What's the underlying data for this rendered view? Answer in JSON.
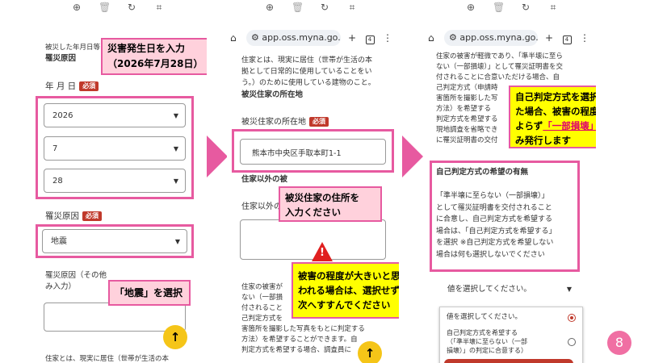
{
  "toolbar_icons": [
    "zoom-in-icon",
    "trash-icon",
    "rotate-icon",
    "crop-icon"
  ],
  "panel1": {
    "header_line1": "被災した年月日等",
    "header_line2": "罹災原因",
    "date_label": "年 月 日",
    "required": "必須",
    "year_value": "2026",
    "month_value": "7",
    "day_value": "28",
    "cause_label": "罹災原因",
    "cause_value": "地震",
    "other_label_line1": "罹災原因（その他",
    "other_label_line2": "み入力）",
    "bottom_text": "住家とは、現実に居住（世帯が生活の本",
    "callout_date_line1": "災害発生日を入力",
    "callout_date_line2": "（2026年7月28日）",
    "callout_cause": "「地震」を選択"
  },
  "panel2": {
    "url": "app.oss.myna.go.jp",
    "intro_line1": "住家とは、現実に居住（世帯が生活の本",
    "intro_line2": "拠として日常的に使用していることをい",
    "intro_line3": "う。）のために使用している建物のこと。",
    "section_title": "被災住家の所在地",
    "address_label": "被災住家の所在地",
    "required": "必須",
    "address_value": "熊本市中央区手取本町1-1",
    "section2_title": "住家以外の被",
    "other_label": "住家以外の",
    "lower_lines": [
      "住家の被害が",
      "ない（一部損",
      "付されること",
      "己判定方式を",
      "害箇所を撮影した写真をもとに判定する",
      "方法）を希望することができます。自",
      "判定方式を希望する場合、調査員に"
    ],
    "callout_address_line1": "被災住家の住所を",
    "callout_address_line2": "入力ください",
    "callout_warn_line1": "被害の程度が大きいと思",
    "callout_warn_line2": "われる場合は、選択せずに",
    "callout_warn_line3": "次へすすんでください"
  },
  "panel3": {
    "url": "app.oss.myna.go.jp",
    "top_lines": [
      "住家の被害が軽微であり、「準半壊に至ら",
      "ない（一部損壊）」として罹災証明書を交",
      "付されることに合意いただける場合、自",
      "己判定方式（申請時",
      "害箇所を撮影した写",
      "方法）を希望する",
      "判定方式を希望する",
      "現地調査を省略でき",
      "に罹災証明書の交付"
    ],
    "section_title": "自己判定方式の希望の有無",
    "desc_lines": [
      "「準半壊に至らない（一部損壊）」",
      "として罹災証明書を交付されること",
      "に合意し、自己判定方式を希望する",
      "場合は、「自己判定方式を希望する」",
      "を選択 ※自己判定方式を希望しない",
      "場合は何も選択しないでください"
    ],
    "select_placeholder": "値を選択してください。",
    "option1": "値を選択してください。",
    "option2_line1": "自己判定方式を希望する",
    "option2_line2": "（「準半壊に至らない（一部",
    "option2_line3": "損壊）」の判定に合意する）",
    "callout_line1": "自己判定方式を選択し",
    "callout_line2": "た場合、被害の程度に",
    "callout_line3_pre": "よらず",
    "callout_line3_emph": "「一部損壊」",
    "callout_line3_post": "での",
    "callout_line4": "み発行します"
  },
  "page_number": "8",
  "colors": {
    "accent_pink": "#e75aa0",
    "callout_pink": "#ffd1dc",
    "required_red": "#c0392b",
    "highlight_yellow": "#ffff00",
    "fab_yellow": "#f5c518"
  }
}
